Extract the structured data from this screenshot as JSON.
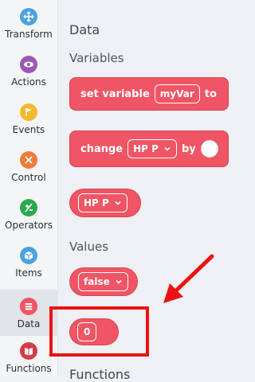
{
  "sidebar": {
    "items": [
      {
        "label": "Transform",
        "color": "#4aa3e0",
        "icon": "transform-icon"
      },
      {
        "label": "Actions",
        "color": "#9b59b6",
        "icon": "eye-icon"
      },
      {
        "label": "Events",
        "color": "#f5b82e",
        "icon": "flag-icon"
      },
      {
        "label": "Control",
        "color": "#f07c3a",
        "icon": "control-icon"
      },
      {
        "label": "Operators",
        "color": "#2ea84f",
        "icon": "operators-icon"
      },
      {
        "label": "Items",
        "color": "#4aa3e0",
        "icon": "cube-icon"
      },
      {
        "label": "Data",
        "color": "#ef5564",
        "icon": "data-icon"
      },
      {
        "label": "Functions",
        "color": "#d63b47",
        "icon": "book-icon"
      }
    ],
    "active": "Data"
  },
  "palette": {
    "title": "Data",
    "section_variables": "Variables",
    "section_values": "Values",
    "section_functions": "Functions",
    "set_variable_block": {
      "label": "set variable",
      "var": "myVar",
      "tail": "to"
    },
    "change_block": {
      "label": "change",
      "var": "HP P",
      "tail": "by"
    },
    "hp_reporter": {
      "label": "HP P"
    },
    "false_reporter": {
      "label": "false"
    },
    "zero_reporter": {
      "value": "0"
    }
  },
  "colors": {
    "data_block": "#ef5564",
    "annotation": "#ee1111"
  }
}
